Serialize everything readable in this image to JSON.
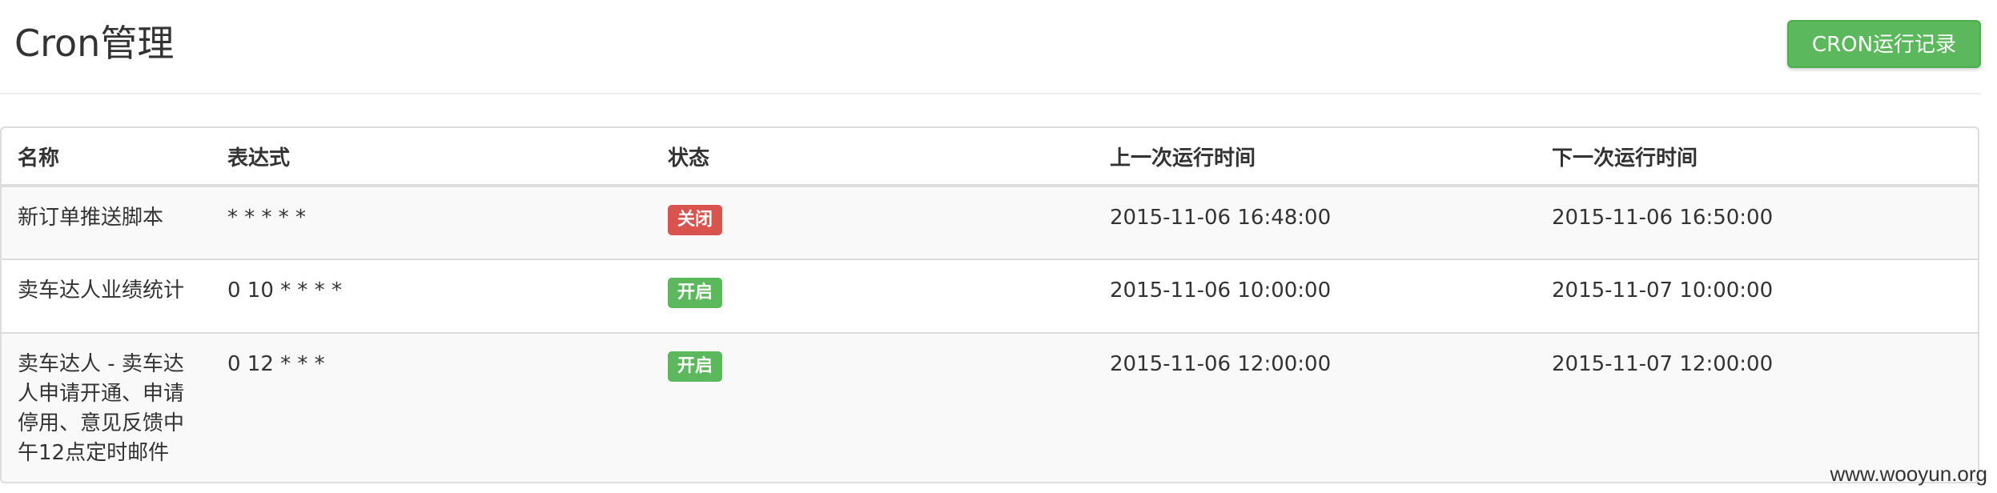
{
  "header": {
    "title": "Cron管理",
    "log_button": "CRON运行记录"
  },
  "table": {
    "columns": [
      "名称",
      "表达式",
      "状态",
      "上一次运行时间",
      "下一次运行时间"
    ],
    "rows": [
      {
        "name": "新订单推送脚本",
        "expression": "* * * * *",
        "status": "关闭",
        "status_color": "#d9534f",
        "last_run": "2015-11-06 16:48:00",
        "next_run": "2015-11-06 16:50:00"
      },
      {
        "name": "卖车达人业绩统计",
        "expression": "0 10 * * * *",
        "status": "开启",
        "status_color": "#5cb85c",
        "last_run": "2015-11-06 10:00:00",
        "next_run": "2015-11-07 10:00:00"
      },
      {
        "name": "卖车达人 - 卖车达人申请开通、申请停用、意见反馈中午12点定时邮件",
        "expression": "0 12 * * *",
        "status": "开启",
        "status_color": "#5cb85c",
        "last_run": "2015-11-06 12:00:00",
        "next_run": "2015-11-07 12:00:00"
      }
    ]
  },
  "watermark": "www.wooyun.org",
  "colors": {
    "success": "#5cb85c",
    "danger": "#d9534f",
    "border": "#dddddd"
  }
}
